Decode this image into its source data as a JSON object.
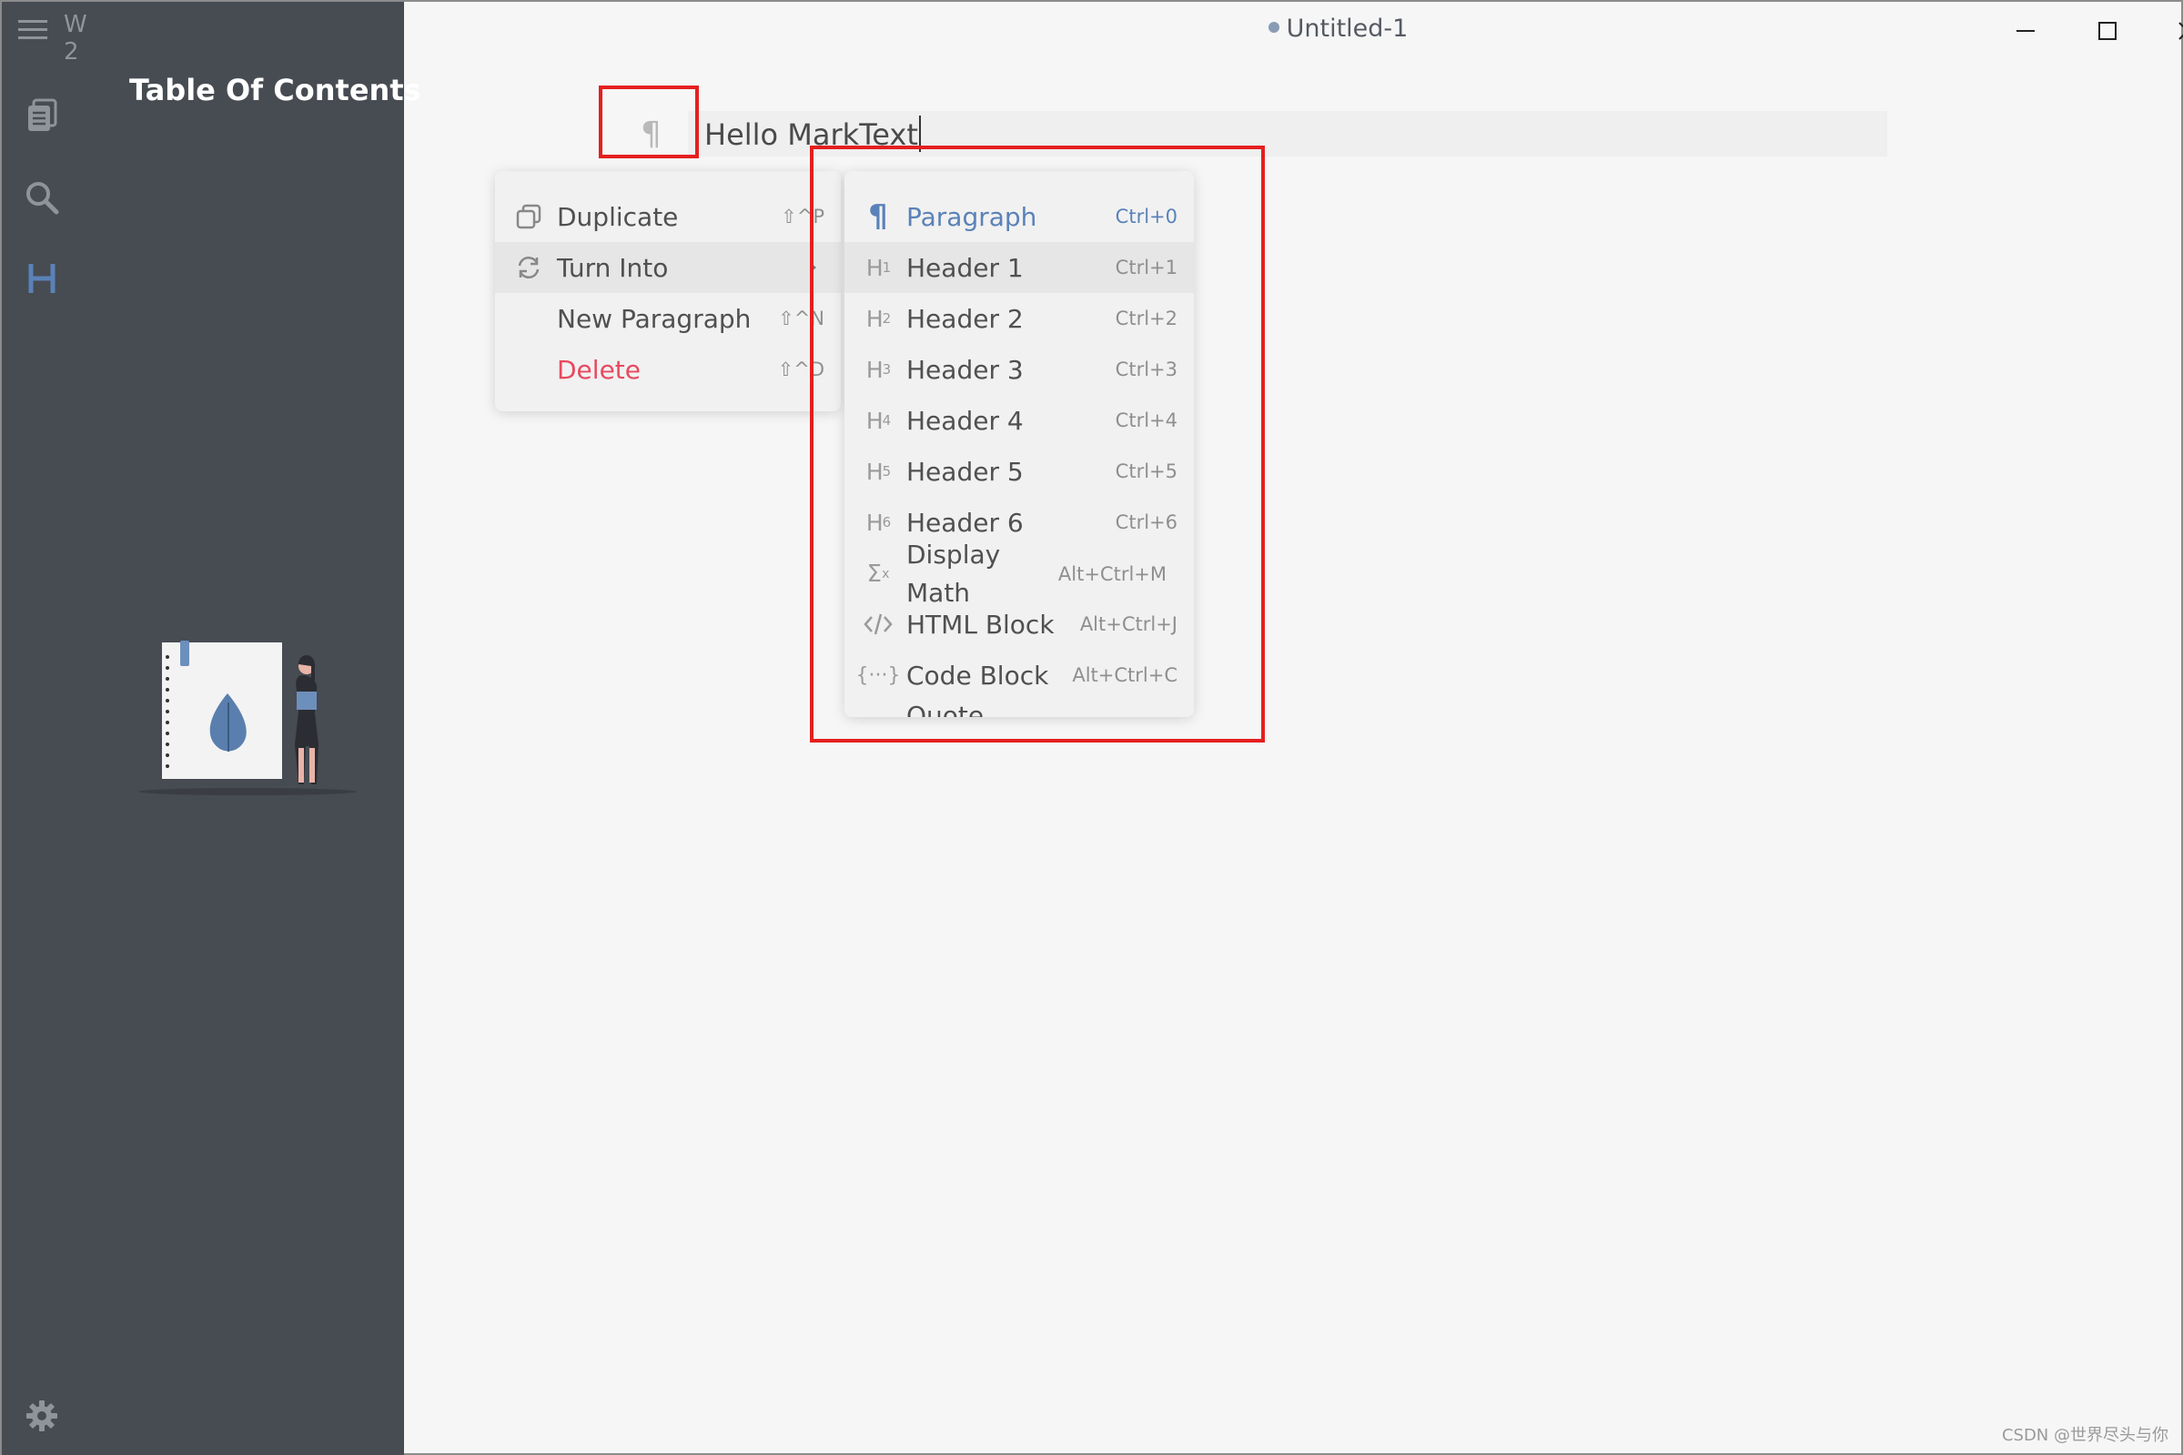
{
  "workspace": {
    "label": "W 2"
  },
  "sidebar": {
    "title": "Table Of Contents"
  },
  "titlebar": {
    "document_title": "Untitled-1"
  },
  "editor": {
    "paragraph_text": "Hello MarkText"
  },
  "block_menu": {
    "items": [
      {
        "label": "Duplicate",
        "shortcut": "⇧^P"
      },
      {
        "label": "Turn Into",
        "shortcut": ""
      },
      {
        "label": "New Paragraph",
        "shortcut": "⇧^N"
      },
      {
        "label": "Delete",
        "shortcut": "⇧^D"
      }
    ]
  },
  "turn_into_menu": {
    "items": [
      {
        "label": "Paragraph",
        "shortcut": "Ctrl+0",
        "icon": "paragraph-icon"
      },
      {
        "label": "Header 1",
        "shortcut": "Ctrl+1",
        "icon": "h1-icon"
      },
      {
        "label": "Header 2",
        "shortcut": "Ctrl+2",
        "icon": "h2-icon"
      },
      {
        "label": "Header 3",
        "shortcut": "Ctrl+3",
        "icon": "h3-icon"
      },
      {
        "label": "Header 4",
        "shortcut": "Ctrl+4",
        "icon": "h4-icon"
      },
      {
        "label": "Header 5",
        "shortcut": "Ctrl+5",
        "icon": "h5-icon"
      },
      {
        "label": "Header 6",
        "shortcut": "Ctrl+6",
        "icon": "h6-icon"
      },
      {
        "label": "Display Math",
        "label_line1": "Display",
        "label_line2": "Math",
        "shortcut": "Alt+Ctrl+M",
        "icon": "sigma-icon"
      },
      {
        "label": "HTML Block",
        "shortcut": "Alt+Ctrl+J",
        "icon": "code-tag-icon"
      },
      {
        "label": "Code Block",
        "shortcut": "Alt+Ctrl+C",
        "icon": "code-block-icon"
      },
      {
        "label": "Quote",
        "shortcut": "",
        "icon": "quote-icon"
      }
    ]
  },
  "heading_digits": [
    "1",
    "2",
    "3",
    "4",
    "5",
    "6"
  ],
  "watermark": {
    "text": "CSDN @世界尽头与你"
  },
  "colors": {
    "sidebar_bg": "#474b52",
    "editor_bg": "#f6f6f6",
    "accent": "#5a82b8",
    "danger": "#e84a5f",
    "annotation": "#e51f1f"
  }
}
